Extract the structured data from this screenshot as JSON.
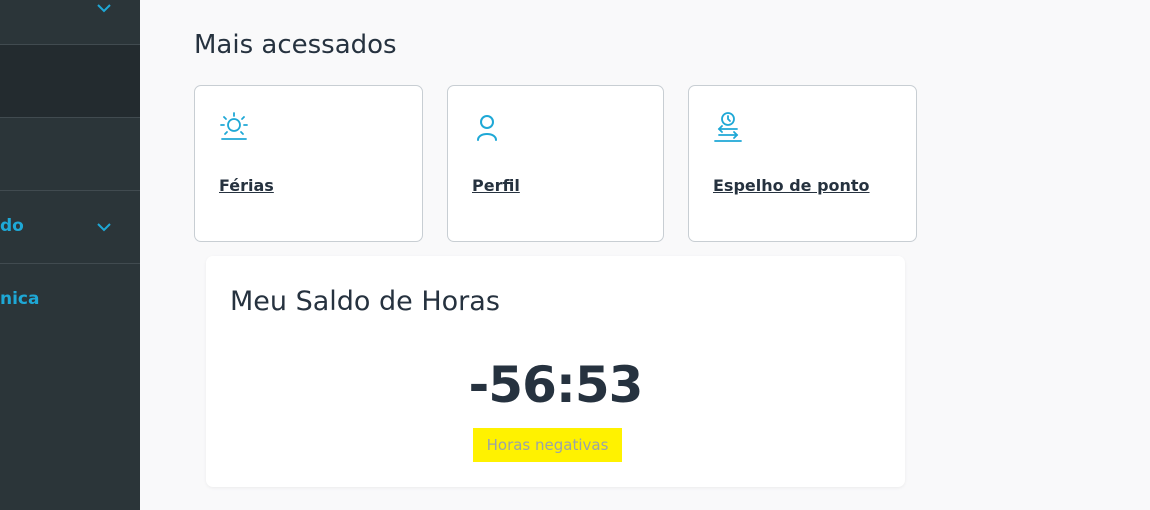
{
  "sidebar": {
    "items": [
      {
        "label": ""
      },
      {
        "label": ""
      },
      {
        "label": ""
      },
      {
        "label": "do"
      },
      {
        "label": "nica"
      }
    ]
  },
  "main": {
    "section_title": "Mais acessados",
    "cards": [
      {
        "label": "Férias",
        "icon": "sun-icon"
      },
      {
        "label": "Perfil",
        "icon": "user-icon"
      },
      {
        "label": "Espelho de ponto",
        "icon": "clock-transfer-icon"
      }
    ],
    "balance": {
      "title": "Meu Saldo de Horas",
      "value": "-56:53",
      "subtitle": "Horas negativas"
    }
  },
  "colors": {
    "accent": "#1ea8d6",
    "sidebar_bg": "#2b3539",
    "text_dark": "#26323f",
    "highlight": "#fff200"
  }
}
